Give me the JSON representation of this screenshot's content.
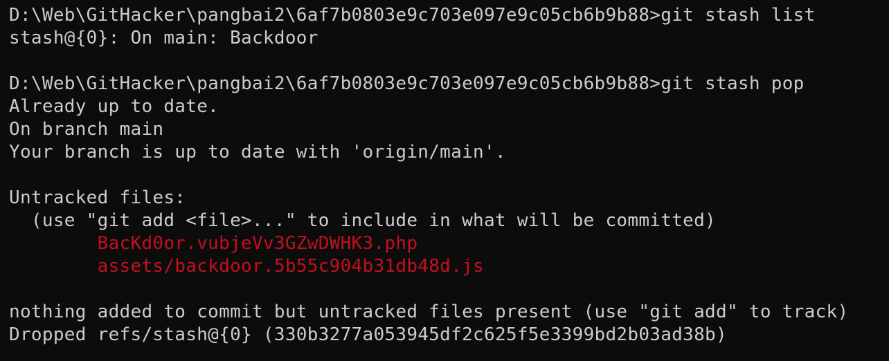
{
  "theme": {
    "background": "#0c0c0c",
    "foreground": "#cccccc",
    "untracked_color": "#c50f1f"
  },
  "terminal": {
    "lines": [
      {
        "text": "D:\\Web\\GitHacker\\pangbai2\\6af7b0803e9c703e097e9c05cb6b9b88>git stash list",
        "kind": "command"
      },
      {
        "text": "stash@{0}: On main: Backdoor",
        "kind": "output"
      },
      {
        "text": "",
        "kind": "blank"
      },
      {
        "text": "D:\\Web\\GitHacker\\pangbai2\\6af7b0803e9c703e097e9c05cb6b9b88>git stash pop",
        "kind": "command"
      },
      {
        "text": "Already up to date.",
        "kind": "output"
      },
      {
        "text": "On branch main",
        "kind": "output"
      },
      {
        "text": "Your branch is up to date with 'origin/main'.",
        "kind": "output"
      },
      {
        "text": "",
        "kind": "blank"
      },
      {
        "text": "Untracked files:",
        "kind": "output"
      },
      {
        "text": "  (use \"git add <file>...\" to include in what will be committed)",
        "kind": "output"
      },
      {
        "text": "        BacKd0or.vubjeVv3GZwDWHK3.php",
        "kind": "untracked"
      },
      {
        "text": "        assets/backdoor.5b55c904b31db48d.js",
        "kind": "untracked"
      },
      {
        "text": "",
        "kind": "blank"
      },
      {
        "text": "nothing added to commit but untracked files present (use \"git add\" to track)",
        "kind": "output"
      },
      {
        "text": "Dropped refs/stash@{0} (330b3277a053945df2c625f5e3399bd2b03ad38b)",
        "kind": "output"
      }
    ]
  }
}
